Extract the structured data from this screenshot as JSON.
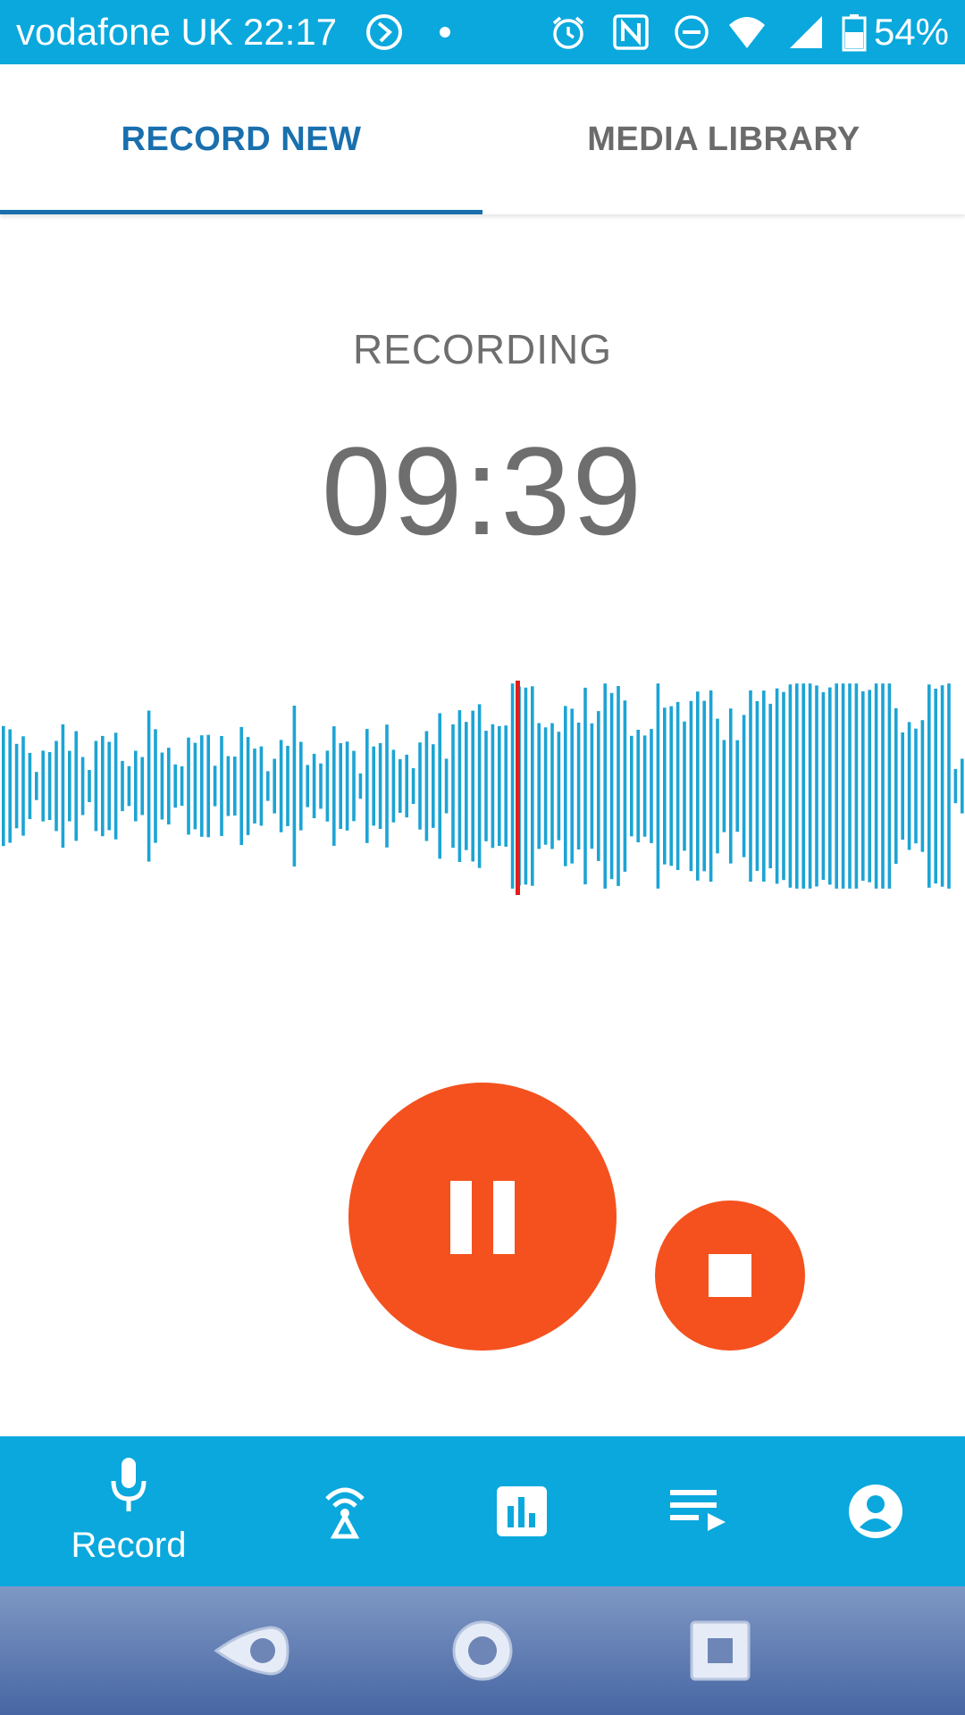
{
  "status_bar": {
    "carrier": "vodafone UK",
    "time": "22:17",
    "battery_percent": "54%",
    "icons": [
      "assistant-icon",
      "notification-dot-icon",
      "alarm-icon",
      "nfc-icon",
      "do-not-disturb-icon",
      "wifi-icon",
      "signal-icon",
      "battery-icon"
    ]
  },
  "tabs": [
    {
      "label": "RECORD NEW",
      "active": true
    },
    {
      "label": "MEDIA LIBRARY",
      "active": false
    }
  ],
  "recording": {
    "status": "RECORDING",
    "elapsed": "09:39"
  },
  "bottom_nav": {
    "items": [
      {
        "label": "Record",
        "icon": "microphone-icon",
        "active": true
      },
      {
        "label": "",
        "icon": "broadcast-icon"
      },
      {
        "label": "",
        "icon": "stats-icon"
      },
      {
        "label": "",
        "icon": "playlist-icon"
      },
      {
        "label": "",
        "icon": "account-icon"
      }
    ]
  },
  "system_nav": {
    "icons": [
      "back-icon",
      "home-icon",
      "recents-icon"
    ]
  },
  "colors": {
    "primary": "#0aa8dd",
    "tab_active": "#1a6fad",
    "text_gray": "#6e6e6e",
    "record_button": "#f4511e",
    "waveform": "#1ca4d4",
    "playhead": "#e01e1e"
  }
}
